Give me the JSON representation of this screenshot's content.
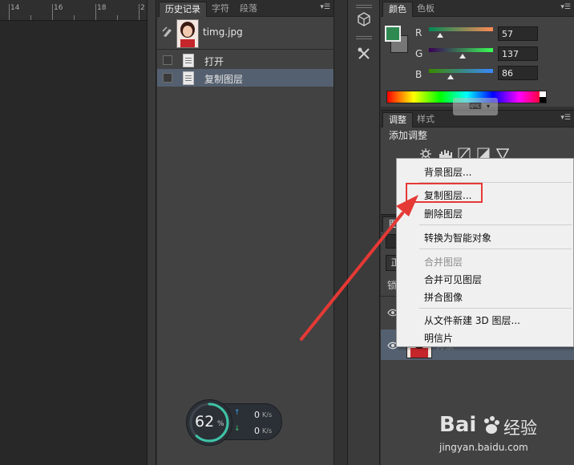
{
  "ruler": {
    "ticks": [
      "14",
      "16",
      "18",
      "2"
    ]
  },
  "history_panel": {
    "tabs": [
      "历史记录",
      "字符",
      "段落"
    ],
    "snapshot_name": "timg.jpg",
    "items": [
      {
        "label": "打开",
        "selected": false
      },
      {
        "label": "复制图层",
        "selected": true
      }
    ]
  },
  "color_panel": {
    "tabs": [
      "颜色",
      "色板"
    ],
    "foreground_color": "#2f8a52",
    "channels": [
      {
        "name": "R",
        "value": "57"
      },
      {
        "name": "G",
        "value": "137"
      },
      {
        "name": "B",
        "value": "86"
      }
    ]
  },
  "adjust_panel": {
    "tabs": [
      "调整",
      "样式"
    ],
    "title": "添加调整"
  },
  "layers_panel": {
    "tab_fragment": "图",
    "lock_fragment": "锁",
    "mode_fragment": "正",
    "layer_name_fragment": "背景"
  },
  "context_menu": {
    "items": [
      {
        "label": "背景图层...",
        "disabled": false
      },
      {
        "label": "复制图层...",
        "disabled": false,
        "highlighted": true
      },
      {
        "label": "删除图层",
        "disabled": false
      },
      {
        "label": "转换为智能对象",
        "disabled": false
      },
      {
        "label": "合并图层",
        "disabled": true
      },
      {
        "label": "合并可见图层",
        "disabled": false
      },
      {
        "label": "拼合图像",
        "disabled": false
      },
      {
        "label": "从文件新建 3D 图层...",
        "disabled": false
      },
      {
        "label": "明信片",
        "disabled": false
      }
    ]
  },
  "network_widget": {
    "percent": "62",
    "percent_unit": "%",
    "upload": "0",
    "download": "0",
    "unit": "K/s",
    "progress": 0.62
  },
  "watermark": {
    "brand": "Bai",
    "brand2": "经验",
    "url": "jingyan.baidu.com"
  },
  "colors": {
    "highlight_box": "#e53935",
    "arrow": "#e53935",
    "selected_row": "#54606f"
  }
}
